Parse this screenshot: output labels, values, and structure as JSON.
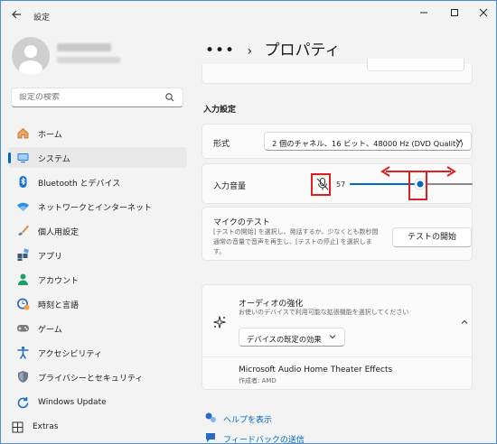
{
  "window": {
    "title": "設定",
    "back_icon": "back-arrow-icon"
  },
  "sidebar": {
    "search_placeholder": "設定の検索",
    "items": [
      {
        "label": "ホーム",
        "icon": "home-icon"
      },
      {
        "label": "システム",
        "icon": "system-display-icon",
        "active": true
      },
      {
        "label": "Bluetooth とデバイス",
        "icon": "bluetooth-icon"
      },
      {
        "label": "ネットワークとインターネット",
        "icon": "wifi-icon"
      },
      {
        "label": "個人用設定",
        "icon": "brush-icon"
      },
      {
        "label": "アプリ",
        "icon": "apps-icon"
      },
      {
        "label": "アカウント",
        "icon": "account-icon"
      },
      {
        "label": "時刻と言語",
        "icon": "time-language-icon"
      },
      {
        "label": "ゲーム",
        "icon": "gamepad-icon"
      },
      {
        "label": "アクセシビリティ",
        "icon": "accessibility-icon"
      },
      {
        "label": "プライバシーとセキュリティ",
        "icon": "shield-icon"
      },
      {
        "label": "Windows Update",
        "icon": "windows-update-icon"
      },
      {
        "label": "Extras",
        "icon": "extras-icon"
      }
    ]
  },
  "main": {
    "breadcrumb": {
      "dots": "•••",
      "separator": "›",
      "title": "プロパティ"
    },
    "input_section_title": "入力設定",
    "format": {
      "label": "形式",
      "value": "2 個のチャネル、16 ビット、48000 Hz (DVD Quality)"
    },
    "input_volume": {
      "label": "入力音量",
      "value": "57",
      "level": 0.57,
      "mic_icon": "microphone-muted-icon"
    },
    "mic_test": {
      "title": "マイクのテスト",
      "description": "[テストの開始] を選択し、発話するか、少なくとも数秒間通常の音量で音声を再生し、[テストの停止] を選択します。",
      "button": "テストの開始"
    },
    "audio_enhancements": {
      "title": "オーディオの強化",
      "description": "お使いのデバイスで利用可能な拡張機能を選択してください",
      "dropdown_value": "デバイスの既定の効果",
      "icon": "sparkle-icon",
      "provider_name": "Microsoft Audio Home Theater Effects",
      "provider_author": "作成者: AMD"
    },
    "links": {
      "help": "ヘルプを表示",
      "feedback": "フィードバックの送信"
    }
  },
  "colors": {
    "accent": "#0067c0",
    "highlight": "#e02020"
  }
}
